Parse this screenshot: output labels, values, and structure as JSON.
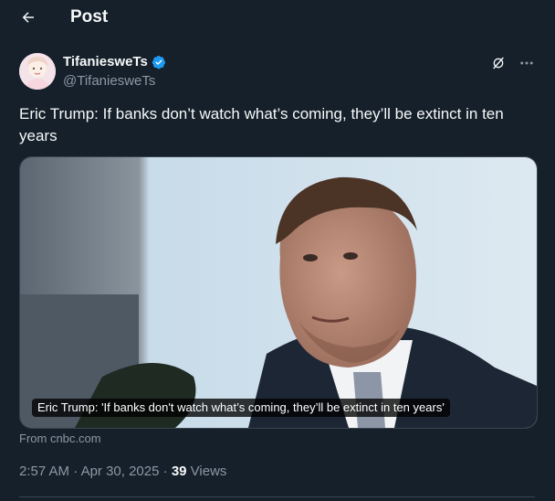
{
  "header": {
    "title": "Post"
  },
  "post": {
    "display_name": "TifaniesweTs",
    "handle": "@TifaniesweTs",
    "text": "Eric Trump: If banks don’t watch what’s coming, they’ll be extinct in ten years",
    "card": {
      "caption": "Eric Trump: 'If banks don't watch what’s coming, they’ll be extinct in ten years'",
      "source": "From cnbc.com"
    },
    "time": "2:57 AM",
    "separator": " · ",
    "date": "Apr 30, 2025",
    "views_count": "39",
    "views_label": " Views"
  },
  "icons": {
    "back": "arrow-left-icon",
    "verified": "verified-badge-icon",
    "grok": "grok-icon",
    "more": "more-icon"
  },
  "colors": {
    "background": "#15202b",
    "text": "#f7f9f9",
    "secondary": "#8b98a5",
    "verified": "#1d9bf0",
    "border": "#38444d"
  }
}
